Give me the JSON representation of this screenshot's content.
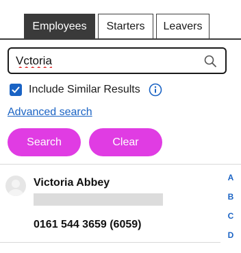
{
  "tabs": [
    {
      "label": "Employees",
      "active": true
    },
    {
      "label": "Starters",
      "active": false
    },
    {
      "label": "Leavers",
      "active": false
    }
  ],
  "search": {
    "value": "Vctoria",
    "placeholder": ""
  },
  "options": {
    "include_similar_label": "Include Similar Results",
    "include_similar_checked": true
  },
  "links": {
    "advanced_search": "Advanced search"
  },
  "buttons": {
    "search_label": "Search",
    "clear_label": "Clear"
  },
  "result": {
    "name": "Victoria Abbey",
    "phone": "0161 544 3659 (6059)"
  },
  "alphabet": [
    "A",
    "B",
    "C",
    "D"
  ],
  "colors": {
    "accent_button": "#e03ce3",
    "link_blue": "#1a63c4",
    "active_tab": "#3a3a3a"
  }
}
